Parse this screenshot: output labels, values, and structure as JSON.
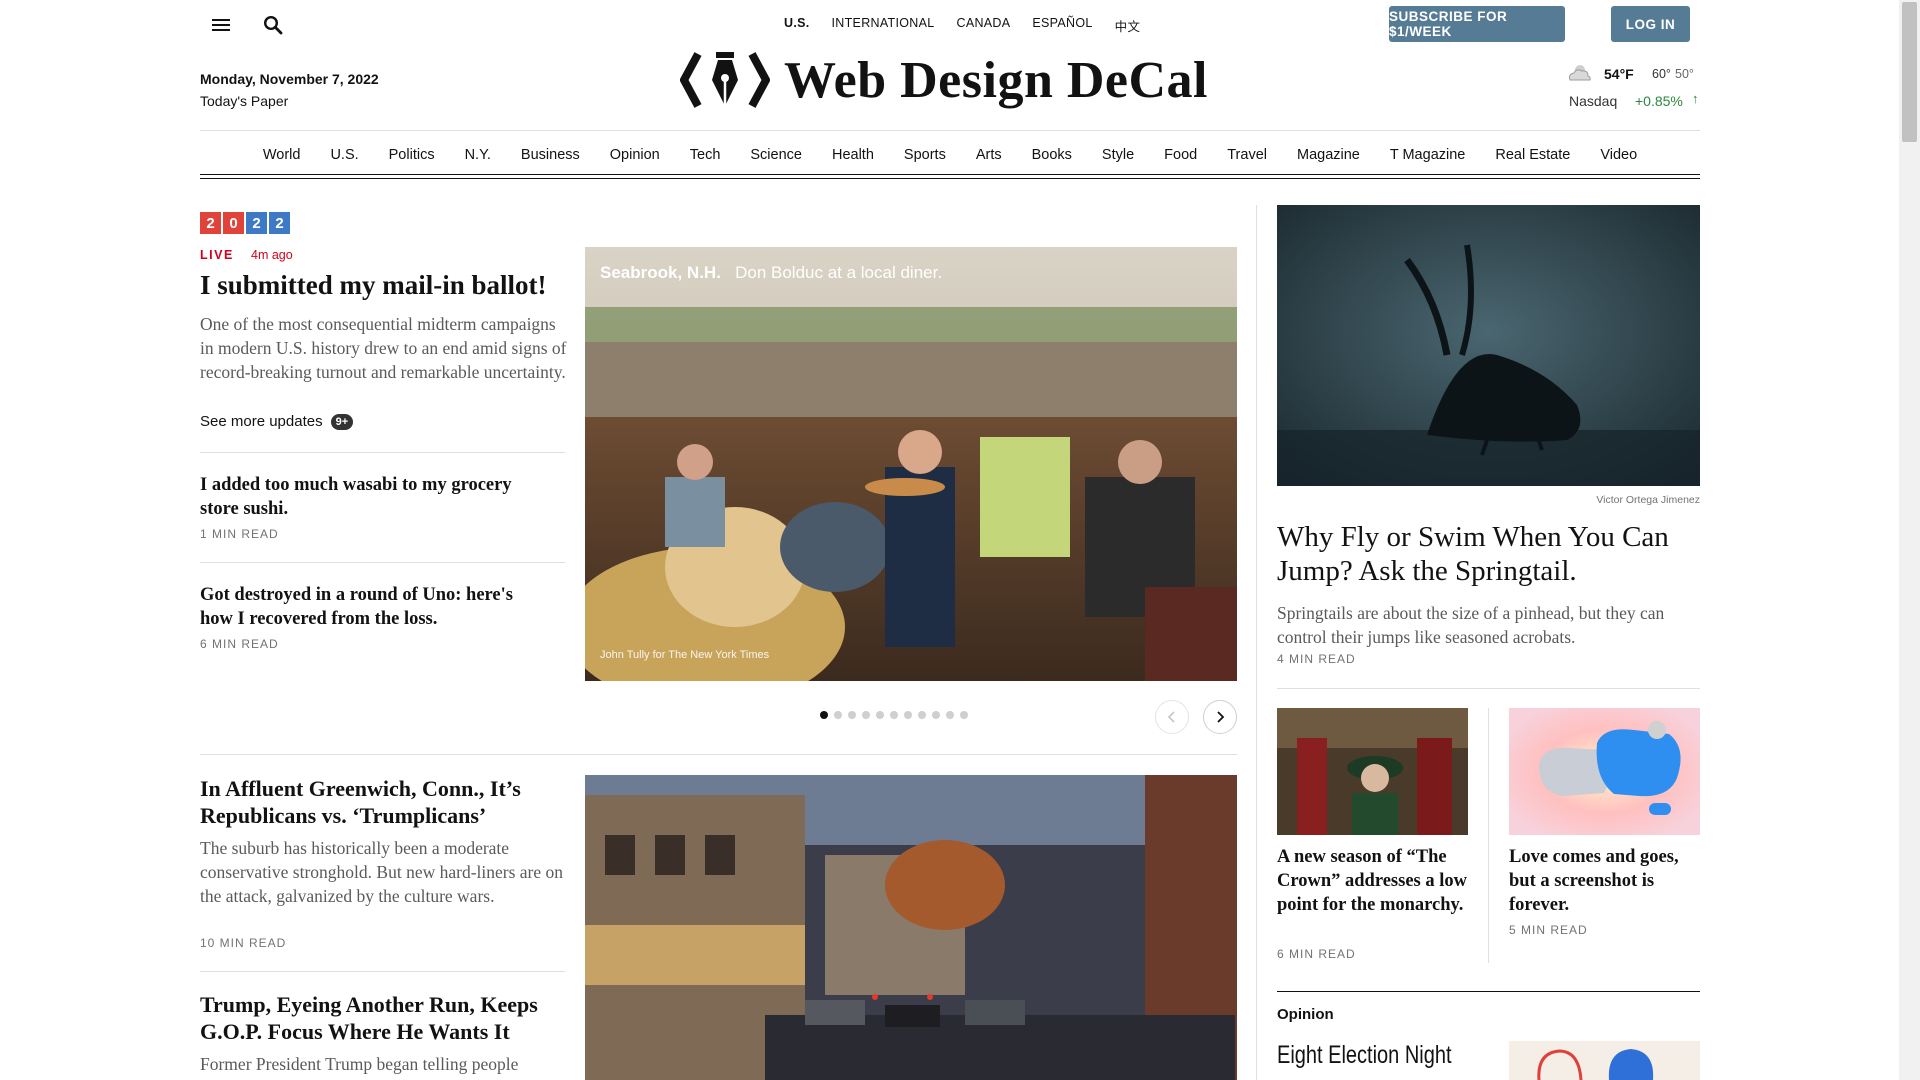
{
  "topbar": {
    "editions": [
      "U.S.",
      "INTERNATIONAL",
      "CANADA",
      "ESPAÑOL",
      "中文"
    ],
    "subscribe_label": "SUBSCRIBE FOR $1/WEEK",
    "login_label": "LOG IN"
  },
  "masthead": {
    "date": "Monday, November 7, 2022",
    "todays_paper": "Today's Paper",
    "title": "Web Design DeCal",
    "weather": {
      "temp": "54°F",
      "high": "60°",
      "low": "50°"
    },
    "market": {
      "name": "Nasdaq",
      "change": "+0.85%",
      "arrow": "↑",
      "color": "#2e8540"
    }
  },
  "nav": [
    "World",
    "U.S.",
    "Politics",
    "N.Y.",
    "Business",
    "Opinion",
    "Tech",
    "Science",
    "Health",
    "Sports",
    "Arts",
    "Books",
    "Style",
    "Food",
    "Travel",
    "Magazine",
    "T Magazine",
    "Real Estate",
    "Video"
  ],
  "election_badge": {
    "digits": [
      "2",
      "0",
      "2",
      "2"
    ],
    "colors": [
      "#e0433a",
      "#e0433a",
      "#3d79c6",
      "#3d79c6"
    ]
  },
  "lead": {
    "live": "LIVE",
    "time_ago": "4m ago",
    "headline": "I submitted my mail-in ballot!",
    "summary": "One of the most consequential midterm campaigns in modern U.S. history drew to an end amid signs of record-breaking turnout and remarkable uncertainty.",
    "see_more": "See more updates",
    "badge": "9+"
  },
  "side_stories": [
    {
      "headline": "I added too much wasabi to my grocery store sushi.",
      "read": "1 MIN READ"
    },
    {
      "headline": "Got destroyed in a round of Uno: here's how I recovered from the loss.",
      "read": "6 MIN READ"
    }
  ],
  "main_photo": {
    "place": "Seabrook, N.H.",
    "caption": "Don Bolduc at a local diner.",
    "credit": "John Tully for The New York Times",
    "dots": 11,
    "active_dot": 0
  },
  "story2": {
    "headline": "In Affluent Greenwich, Conn., It’s Republicans vs. ‘Trumplicans’",
    "summary": "The suburb has historically been a moderate conservative stronghold. But new hard-liners are on the attack, galvanized by the culture wars.",
    "read": "10 MIN READ"
  },
  "story3": {
    "headline": "Trump, Eyeing Another Run, Keeps G.O.P. Focus Where He Wants It",
    "summary": "Former President Trump began telling people"
  },
  "right_feature": {
    "credit": "Victor Ortega Jimenez",
    "headline": "Why Fly or Swim When You Can Jump? Ask the Springtail.",
    "summary": "Springtails are about the size of a pinhead, but they can control their jumps like seasoned acrobats.",
    "read": "4 MIN READ"
  },
  "right_small": [
    {
      "headline": "A new season of “The Crown” addresses a low point for the monarchy.",
      "read": "6 MIN READ"
    },
    {
      "headline": "Love comes and goes, but a screenshot is forever.",
      "read": "5 MIN READ"
    }
  ],
  "opinion": {
    "label": "Opinion",
    "headline": "Eight Election Night"
  }
}
